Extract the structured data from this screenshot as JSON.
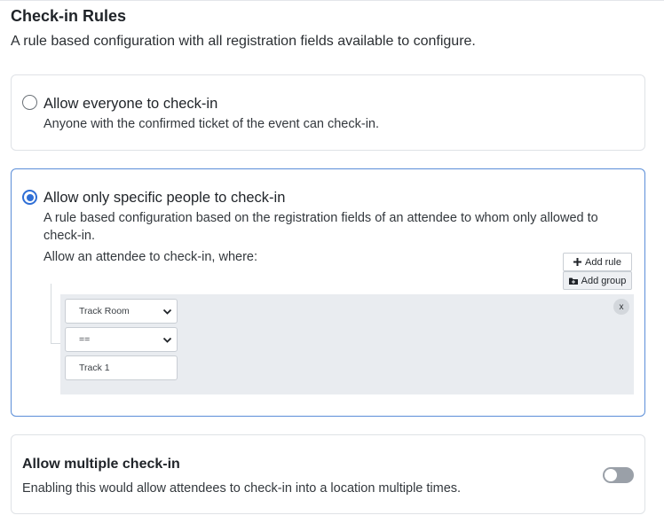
{
  "section": {
    "title": "Check-in Rules",
    "description": "A rule based configuration with all registration fields available to configure."
  },
  "options": [
    {
      "title": "Allow everyone to check-in",
      "description": "Anyone with the confirmed ticket of the event can check-in.",
      "selected": false
    },
    {
      "title": "Allow only specific people to check-in",
      "description": "A rule based configuration based on the registration fields of an attendee to whom only allowed to check-in.",
      "where_label": "Allow an attendee to check-in, where:",
      "selected": true
    }
  ],
  "rule_builder": {
    "add_rule_label": "Add rule",
    "add_group_label": "Add group",
    "field_value": "Track Room",
    "operator_value": "==",
    "input_value": "Track 1",
    "remove_label": "x"
  },
  "multiple_checkin": {
    "title": "Allow multiple check-in",
    "description": "Enabling this would allow attendees to check-in into a location multiple times.",
    "enabled": false
  },
  "colors": {
    "accent": "#2f6fd6",
    "selected_border": "#5b8ed8",
    "rule_area_bg": "#e9ecf0"
  }
}
